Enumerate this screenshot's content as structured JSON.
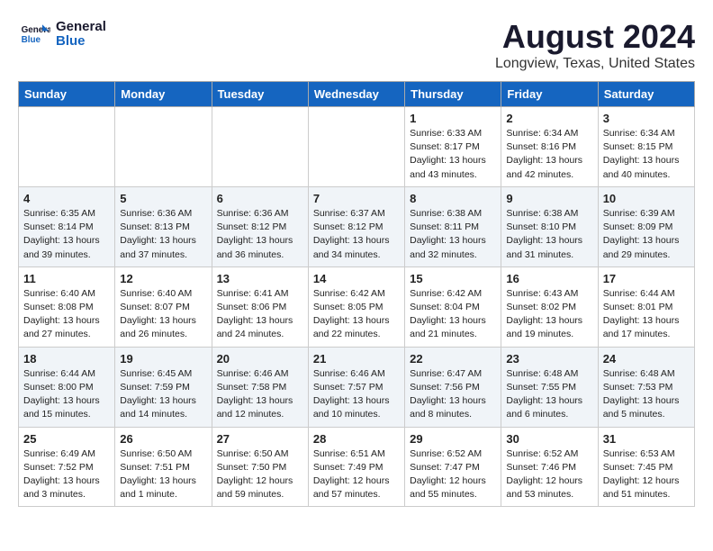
{
  "header": {
    "logo_line1": "General",
    "logo_line2": "Blue",
    "main_title": "August 2024",
    "subtitle": "Longview, Texas, United States"
  },
  "days_of_week": [
    "Sunday",
    "Monday",
    "Tuesday",
    "Wednesday",
    "Thursday",
    "Friday",
    "Saturday"
  ],
  "weeks": [
    [
      {
        "num": "",
        "info": ""
      },
      {
        "num": "",
        "info": ""
      },
      {
        "num": "",
        "info": ""
      },
      {
        "num": "",
        "info": ""
      },
      {
        "num": "1",
        "info": "Sunrise: 6:33 AM\nSunset: 8:17 PM\nDaylight: 13 hours and 43 minutes."
      },
      {
        "num": "2",
        "info": "Sunrise: 6:34 AM\nSunset: 8:16 PM\nDaylight: 13 hours and 42 minutes."
      },
      {
        "num": "3",
        "info": "Sunrise: 6:34 AM\nSunset: 8:15 PM\nDaylight: 13 hours and 40 minutes."
      }
    ],
    [
      {
        "num": "4",
        "info": "Sunrise: 6:35 AM\nSunset: 8:14 PM\nDaylight: 13 hours and 39 minutes."
      },
      {
        "num": "5",
        "info": "Sunrise: 6:36 AM\nSunset: 8:13 PM\nDaylight: 13 hours and 37 minutes."
      },
      {
        "num": "6",
        "info": "Sunrise: 6:36 AM\nSunset: 8:12 PM\nDaylight: 13 hours and 36 minutes."
      },
      {
        "num": "7",
        "info": "Sunrise: 6:37 AM\nSunset: 8:12 PM\nDaylight: 13 hours and 34 minutes."
      },
      {
        "num": "8",
        "info": "Sunrise: 6:38 AM\nSunset: 8:11 PM\nDaylight: 13 hours and 32 minutes."
      },
      {
        "num": "9",
        "info": "Sunrise: 6:38 AM\nSunset: 8:10 PM\nDaylight: 13 hours and 31 minutes."
      },
      {
        "num": "10",
        "info": "Sunrise: 6:39 AM\nSunset: 8:09 PM\nDaylight: 13 hours and 29 minutes."
      }
    ],
    [
      {
        "num": "11",
        "info": "Sunrise: 6:40 AM\nSunset: 8:08 PM\nDaylight: 13 hours and 27 minutes."
      },
      {
        "num": "12",
        "info": "Sunrise: 6:40 AM\nSunset: 8:07 PM\nDaylight: 13 hours and 26 minutes."
      },
      {
        "num": "13",
        "info": "Sunrise: 6:41 AM\nSunset: 8:06 PM\nDaylight: 13 hours and 24 minutes."
      },
      {
        "num": "14",
        "info": "Sunrise: 6:42 AM\nSunset: 8:05 PM\nDaylight: 13 hours and 22 minutes."
      },
      {
        "num": "15",
        "info": "Sunrise: 6:42 AM\nSunset: 8:04 PM\nDaylight: 13 hours and 21 minutes."
      },
      {
        "num": "16",
        "info": "Sunrise: 6:43 AM\nSunset: 8:02 PM\nDaylight: 13 hours and 19 minutes."
      },
      {
        "num": "17",
        "info": "Sunrise: 6:44 AM\nSunset: 8:01 PM\nDaylight: 13 hours and 17 minutes."
      }
    ],
    [
      {
        "num": "18",
        "info": "Sunrise: 6:44 AM\nSunset: 8:00 PM\nDaylight: 13 hours and 15 minutes."
      },
      {
        "num": "19",
        "info": "Sunrise: 6:45 AM\nSunset: 7:59 PM\nDaylight: 13 hours and 14 minutes."
      },
      {
        "num": "20",
        "info": "Sunrise: 6:46 AM\nSunset: 7:58 PM\nDaylight: 13 hours and 12 minutes."
      },
      {
        "num": "21",
        "info": "Sunrise: 6:46 AM\nSunset: 7:57 PM\nDaylight: 13 hours and 10 minutes."
      },
      {
        "num": "22",
        "info": "Sunrise: 6:47 AM\nSunset: 7:56 PM\nDaylight: 13 hours and 8 minutes."
      },
      {
        "num": "23",
        "info": "Sunrise: 6:48 AM\nSunset: 7:55 PM\nDaylight: 13 hours and 6 minutes."
      },
      {
        "num": "24",
        "info": "Sunrise: 6:48 AM\nSunset: 7:53 PM\nDaylight: 13 hours and 5 minutes."
      }
    ],
    [
      {
        "num": "25",
        "info": "Sunrise: 6:49 AM\nSunset: 7:52 PM\nDaylight: 13 hours and 3 minutes."
      },
      {
        "num": "26",
        "info": "Sunrise: 6:50 AM\nSunset: 7:51 PM\nDaylight: 13 hours and 1 minute."
      },
      {
        "num": "27",
        "info": "Sunrise: 6:50 AM\nSunset: 7:50 PM\nDaylight: 12 hours and 59 minutes."
      },
      {
        "num": "28",
        "info": "Sunrise: 6:51 AM\nSunset: 7:49 PM\nDaylight: 12 hours and 57 minutes."
      },
      {
        "num": "29",
        "info": "Sunrise: 6:52 AM\nSunset: 7:47 PM\nDaylight: 12 hours and 55 minutes."
      },
      {
        "num": "30",
        "info": "Sunrise: 6:52 AM\nSunset: 7:46 PM\nDaylight: 12 hours and 53 minutes."
      },
      {
        "num": "31",
        "info": "Sunrise: 6:53 AM\nSunset: 7:45 PM\nDaylight: 12 hours and 51 minutes."
      }
    ]
  ]
}
